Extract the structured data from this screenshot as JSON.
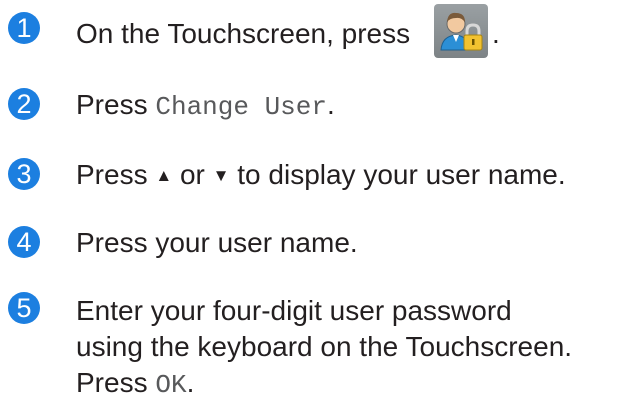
{
  "steps": [
    {
      "number": "1",
      "text": "On the Touchscreen, press",
      "icon": "user-lock-icon",
      "after": "."
    },
    {
      "number": "2",
      "prefix": "Press ",
      "code": "Change User",
      "suffix": "."
    },
    {
      "number": "3",
      "prefix": "Press ",
      "up": "▲",
      "middle": " or ",
      "down": "▼",
      "suffix": " to display your user name."
    },
    {
      "number": "4",
      "text": "Press your user name."
    },
    {
      "number": "5",
      "line1": "Enter your four-digit user password",
      "line2": "using the keyboard on the Touchscreen.",
      "line3_prefix": "Press ",
      "line3_code": "OK",
      "line3_suffix": "."
    }
  ],
  "colors": {
    "step_badge": "#1c7fe0",
    "text": "#231f20",
    "code_text": "#58595b",
    "icon_bg": "#8c9295"
  }
}
